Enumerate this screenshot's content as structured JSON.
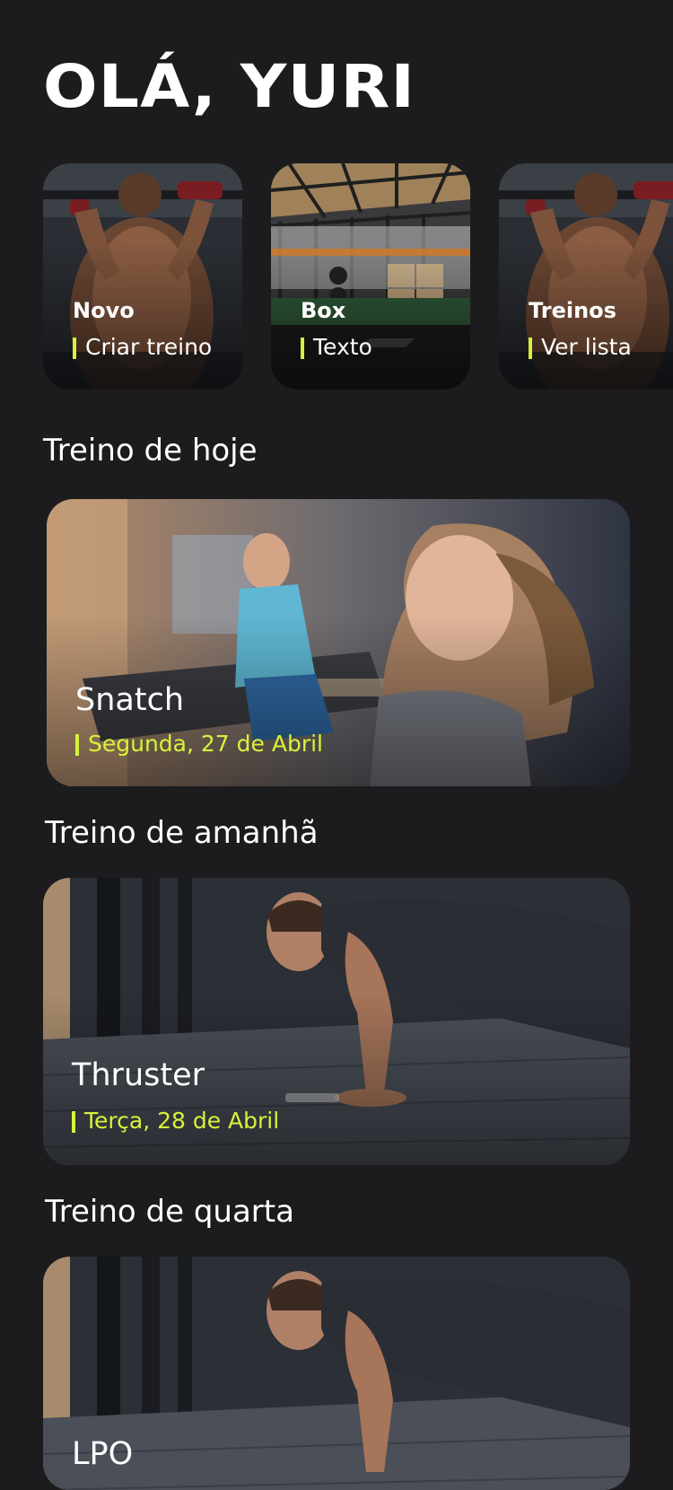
{
  "greeting": "OLÁ, YURI",
  "quick_cards": [
    {
      "title": "Novo",
      "subtitle": "Criar treino",
      "image": "man-pullup-photo"
    },
    {
      "title": "Box",
      "subtitle": "Texto",
      "image": "crossfit-box-photo"
    },
    {
      "title": "Treinos",
      "subtitle": "Ver lista",
      "image": "man-pullup-photo"
    }
  ],
  "sections": [
    {
      "heading": "Treino de hoje",
      "workout": "Snatch",
      "date": "Segunda, 27 de Abril",
      "image": "women-treadmill-photo"
    },
    {
      "heading": "Treino de amanhã",
      "workout": "Thruster",
      "date": "Terça, 28 de Abril",
      "image": "man-pushup-photo"
    },
    {
      "heading": "Treino de quarta",
      "workout": "LPO",
      "date": "",
      "image": "man-pushup-photo"
    }
  ],
  "colors": {
    "background": "#1c1c1e",
    "accent": "#d7f23a",
    "text": "#ffffff"
  }
}
